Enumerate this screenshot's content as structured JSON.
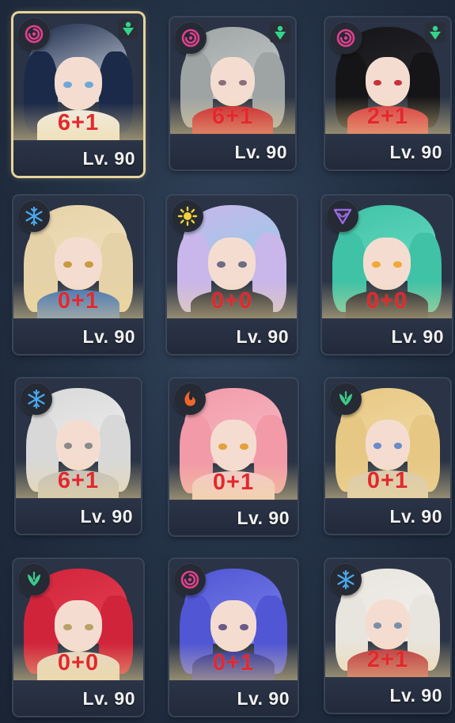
{
  "cards": [
    {
      "level": "Lv. 90",
      "overlay": "6+1",
      "element": "psychic-icon",
      "role": "support-icon",
      "selected": true,
      "hair": "#1c2a4a",
      "hair2": "#dfe6ef",
      "eye": "#6fa8d8",
      "outfit": "#f0ece4"
    },
    {
      "level": "Lv. 90",
      "overlay": "6+1",
      "element": "psychic-icon",
      "role": "support-icon",
      "selected": false,
      "hair": "#9ea3a4",
      "hair2": "#c7cbcc",
      "eye": "#8a6f7a",
      "outfit": "#c81e2a"
    },
    {
      "level": "Lv. 90",
      "overlay": "2+1",
      "element": "psychic-icon",
      "role": "support-icon",
      "selected": false,
      "hair": "#151518",
      "hair2": "#2a2a2f",
      "eye": "#c8303a",
      "outfit": "#d7353d"
    },
    {
      "level": "Lv. 90",
      "overlay": "0+1",
      "element": "ice-icon",
      "role": null,
      "selected": false,
      "hair": "#e6d2a8",
      "hair2": "#f1e2c0",
      "eye": "#c99a44",
      "outfit": "#3b6fb8"
    },
    {
      "level": "Lv. 90",
      "overlay": "0+0",
      "element": "physical-icon",
      "role": null,
      "selected": false,
      "hair": "#c9b6ea",
      "hair2": "#8fd0e8",
      "eye": "#6c6c84",
      "outfit": "#2b2f3a"
    },
    {
      "level": "Lv. 90",
      "overlay": "0+0",
      "element": "ether-icon",
      "role": null,
      "selected": false,
      "hair": "#3fc2a6",
      "hair2": "#6adcc4",
      "eye": "#f0a838",
      "outfit": "#1f2430"
    },
    {
      "level": "Lv. 90",
      "overlay": "6+1",
      "element": "ice-icon",
      "role": null,
      "selected": false,
      "hair": "#d8d8d8",
      "hair2": "#efefef",
      "eye": "#8a8a8a",
      "outfit": "#c0c0c0"
    },
    {
      "level": "Lv. 90",
      "overlay": "0+1",
      "element": "fire-icon",
      "role": null,
      "selected": false,
      "hair": "#f29aa8",
      "hair2": "#f7bcc6",
      "eye": "#e4a03c",
      "outfit": "#f3c9cc"
    },
    {
      "level": "Lv. 90",
      "overlay": "0+1",
      "element": "wind-icon",
      "role": null,
      "selected": false,
      "hair": "#e7c784",
      "hair2": "#f3dca6",
      "eye": "#6a8ac8",
      "outfit": "#d8c9b0"
    },
    {
      "level": "Lv. 90",
      "overlay": "0+0",
      "element": "wind-icon",
      "role": null,
      "selected": false,
      "hair": "#d0243a",
      "hair2": "#e84254",
      "eye": "#b8a268",
      "outfit": "#e6d8c6"
    },
    {
      "level": "Lv. 90",
      "overlay": "0+1",
      "element": "psychic-icon",
      "role": null,
      "selected": false,
      "hair": "#5056d4",
      "hair2": "#7b82ea",
      "eye": "#6a5a8a",
      "outfit": "#2a2f9c"
    },
    {
      "level": "Lv. 90",
      "overlay": "2+1",
      "element": "ice-icon",
      "role": null,
      "selected": false,
      "hair": "#e8e4de",
      "hair2": "#f4f1ec",
      "eye": "#7a8fa8",
      "outfit": "#b8303c"
    }
  ],
  "colors": {
    "psychic": "#e0408c",
    "ice": "#4aa8ec",
    "physical": "#f2d23a",
    "ether": "#9a6ae0",
    "fire": "#f0662a",
    "wind": "#3ec98a",
    "support": "#34d58a",
    "overlay_text": "#e2292d",
    "selected_border": "#e6d49a"
  }
}
